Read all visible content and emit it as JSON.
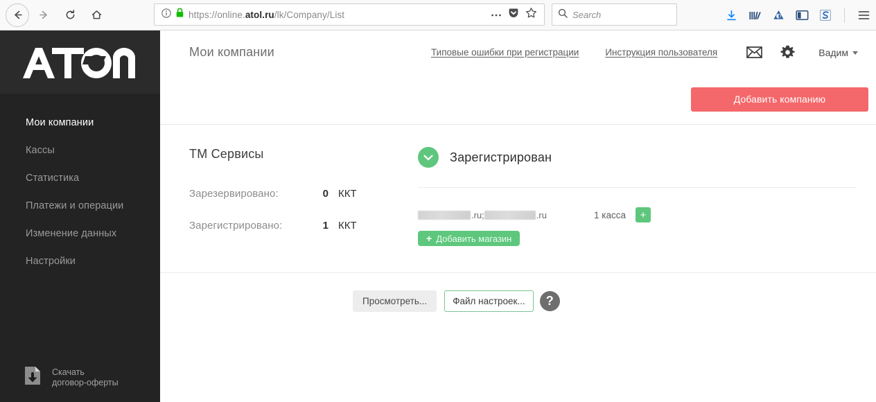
{
  "browser": {
    "nav": {
      "back": "back-arrow",
      "forward": "forward-arrow",
      "reload": "reload",
      "home": "home"
    },
    "url": {
      "prefix": "https://online.",
      "domain": "atol.ru",
      "path": "/lk/Company/List",
      "info_icon": "page-info",
      "lock_icon": "secure-lock"
    },
    "url_actions": [
      "more-dots",
      "pocket-save",
      "bookmark-star"
    ],
    "search": {
      "placeholder": "Search",
      "icon": "search-icon"
    },
    "toolbar_icons": [
      "downloads-icon",
      "library-icon",
      "droplet-icon",
      "sidebar-toggle-icon",
      "evernote-icon",
      "menu-icon"
    ]
  },
  "sidebar": {
    "logo_alt": "ATOL",
    "items": [
      {
        "label": "Мои компании",
        "active": true
      },
      {
        "label": "Кассы",
        "active": false
      },
      {
        "label": "Статистика",
        "active": false
      },
      {
        "label": "Платежи и операции",
        "active": false
      },
      {
        "label": "Изменение данных",
        "active": false
      },
      {
        "label": "Настройки",
        "active": false
      }
    ],
    "offer": {
      "label": "Скачать\nдоговор-оферты",
      "icon": "document-download-icon"
    },
    "bg_color": "#232323",
    "logo_bg_color": "#2b2b2b"
  },
  "header": {
    "title": "Мои компании",
    "links": [
      {
        "label": "Типовые ошибки при регистрации"
      },
      {
        "label": "Инструкция пользователя"
      }
    ],
    "mail_icon": "envelope-icon",
    "settings_icon": "gear-icon",
    "user": {
      "name": "Вадим",
      "caret": "caret-down-icon"
    }
  },
  "actions": {
    "add_company": "Добавить компанию",
    "add_company_color": "#f4676a"
  },
  "company": {
    "name": "ТМ Сервисы",
    "stats": [
      {
        "label": "Зарезервировано:",
        "value": "0",
        "unit": "ККТ"
      },
      {
        "label": "Зарегистрировано:",
        "value": "1",
        "unit": "ККТ"
      }
    ],
    "status": {
      "text": "Зарегистрирован",
      "icon": "chevron-down-circle-icon",
      "color": "#5ec77d"
    },
    "shop": {
      "domain_suffix_1": ".ru;",
      "domain_suffix_2": ".ru",
      "kassa_label": "1 касса",
      "add_kassa": "+",
      "add_shop": "Добавить магазин",
      "add_shop_plus": "+"
    },
    "buttons": {
      "view": "Просмотреть...",
      "settings_file": "Файл настроек...",
      "help": "?"
    }
  }
}
